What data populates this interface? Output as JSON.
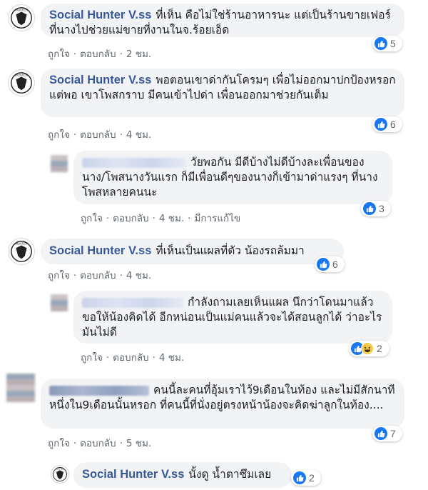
{
  "comments": [
    {
      "author": "Social Hunter V.ss",
      "text": "ที่เห็น คือไม่ใช่ร้านอาหารนะ แต่เป็นร้านขายเฟอร์ ที่นางไปช่วยแม่ขายที่งานในจ.ร้อยเอ็ด",
      "reactions": "5",
      "like": "ถูกใจ",
      "reply": "ตอบกลับ",
      "time": "2 ชม."
    },
    {
      "author": "Social Hunter V.ss",
      "text": "พอตอนเขาด่ากันโครมๆ เพื่อไม่ออกมาปกป้องหรอก แต่พอ เขาโพสกราบ มีคนเข้าไปด่า เพื่อนออกมาช่วยกันเต็ม",
      "reactions": "6",
      "like": "ถูกใจ",
      "reply": "ตอบกลับ",
      "time": "4 ชม."
    },
    {
      "author": "",
      "text": "วัยพอกัน มีดีบ้างไม่ดีบ้างละเพื่อนของนาง/โพสนางวันแรก ก็มีเพื่อนดีๆของนางก็เข้ามาด่าแรงๆ ที่นางโพสหลายคนนะ",
      "reactions": "3",
      "like": "ถูกใจ",
      "reply": "ตอบกลับ",
      "time": "4 ชม.",
      "edited": "มีการแก้ไข"
    },
    {
      "author": "Social Hunter V.ss",
      "text": "ที่เห็นเป็นแผลที่ตัว น้องรถล้มมา",
      "reactions": "6",
      "like": "ถูกใจ",
      "reply": "ตอบกลับ",
      "time": "4 ชม."
    },
    {
      "author": "",
      "text": "กำลังถามเลยเห็นแผล นึกว่าโดนมาแล้ว ขอให้น้องคิดได้ อีกหน่อนเป็นแม่คนแล้วจะได้สอนลูกได้ ว่าอะไรมันไม่ดี",
      "reactions": "2",
      "like": "ถูกใจ",
      "reply": "ตอบกลับ",
      "time": "4 ชม."
    },
    {
      "author": "",
      "text": "คนนี้ละคนที่อุ้มเราไว้9เดือนในท้อง และไม่มีสักนาทีหนึ่งใน9เดือนนั้นหรอก ที่คนนี้ที่นั่งอยู่ตรงหน้าน้องจะคิดฆ่าลูกในท้อง....",
      "reactions": "7",
      "like": "ถูกใจ",
      "reply": "ตอบกลับ",
      "time": "5 ชม."
    },
    {
      "author": "Social Hunter V.ss",
      "text": "นั้งดู น้ำตาซึมเลย",
      "reactions": "2"
    }
  ],
  "logo_text": "HUNTER",
  "colors": {
    "link": "#385898",
    "like": "#1877f2",
    "bubble": "#f2f3f5",
    "meta": "#606770"
  }
}
